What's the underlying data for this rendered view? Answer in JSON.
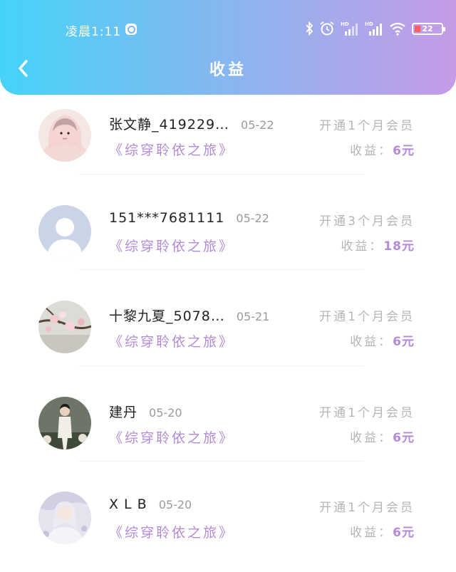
{
  "status_bar": {
    "time": "凌晨1:11",
    "battery_level": "22",
    "battery_percent": 22,
    "icons": [
      "app-notification-icon",
      "bluetooth-icon",
      "alarm-icon",
      "hd-signal-icon",
      "hd-signal-icon",
      "wifi-icon",
      "battery-icon"
    ]
  },
  "header": {
    "title": "收益",
    "back_icon": "chevron-left-icon"
  },
  "colors": {
    "gradient_start": "#45d3f8",
    "gradient_end": "#c59be6",
    "accent": "#b38ad8",
    "muted": "#b5b5b5"
  },
  "records": [
    {
      "name": "张文静_419229…",
      "date": "05-22",
      "book": "《综穿聆依之旅》",
      "membership": "开通1个月会员",
      "income_label": "收益：",
      "income_amount": "6元",
      "avatar": "girl-photo-avatar"
    },
    {
      "name": "151***7681111",
      "date": "05-22",
      "book": "《综穿聆依之旅》",
      "membership": "开通3个月会员",
      "income_label": "收益：",
      "income_amount": "18元",
      "avatar": "default-user-avatar"
    },
    {
      "name": "十黎九夏_5078…",
      "date": "05-21",
      "book": "《综穿聆依之旅》",
      "membership": "开通1个月会员",
      "income_label": "收益：",
      "income_amount": "6元",
      "avatar": "blossom-photo-avatar"
    },
    {
      "name": "建丹",
      "date": "05-20",
      "book": "《综穿聆依之旅》",
      "membership": "开通1个月会员",
      "income_label": "收益：",
      "income_amount": "6元",
      "avatar": "man-photo-avatar"
    },
    {
      "name": "X L B",
      "date": "05-20",
      "book": "《综穿聆依之旅》",
      "membership": "开通1个月会员",
      "income_label": "收益：",
      "income_amount": "6元",
      "avatar": "costume-photo-avatar"
    }
  ]
}
